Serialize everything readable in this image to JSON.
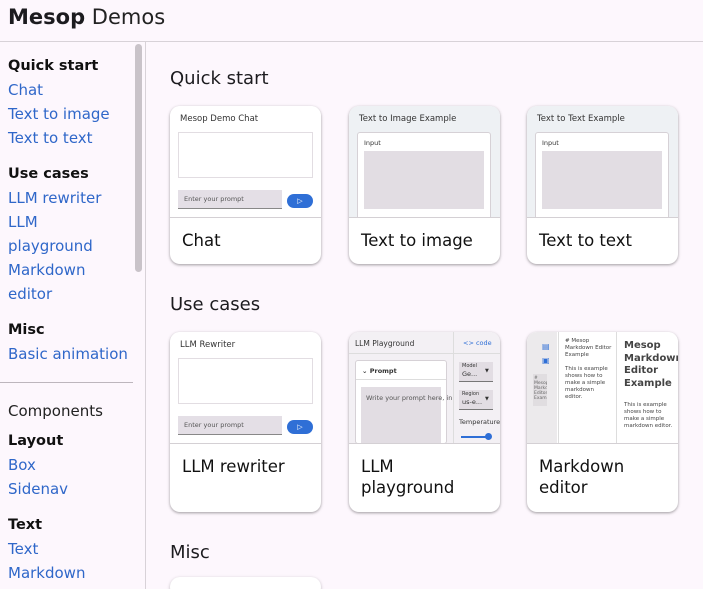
{
  "header": {
    "brand_bold": "Mesop",
    "brand_light": "Demos"
  },
  "sidebar": {
    "quick_start": {
      "title": "Quick start",
      "items": [
        "Chat",
        "Text to image",
        "Text to text"
      ]
    },
    "use_cases": {
      "title": "Use cases",
      "items": [
        "LLM rewriter",
        "LLM",
        "playground",
        "Markdown",
        "editor"
      ]
    },
    "misc": {
      "title": "Misc",
      "items": [
        "Basic animation"
      ]
    },
    "components_label": "Components",
    "layout": {
      "title": "Layout",
      "items": [
        "Box",
        "Sidenav"
      ]
    },
    "text": {
      "title": "Text",
      "items": [
        "Text",
        "Markdown"
      ]
    }
  },
  "main": {
    "sections": {
      "quick_start": "Quick start",
      "use_cases": "Use cases",
      "misc": "Misc"
    },
    "cards": {
      "chat": {
        "label": "Chat",
        "thumb_title": "Mesop Demo Chat",
        "thumb_placeholder": "Enter your prompt",
        "thumb_send": "▷"
      },
      "text_to_image": {
        "label": "Text to image",
        "thumb_title": "Text to Image Example",
        "thumb_input": "Input"
      },
      "text_to_text": {
        "label": "Text to text",
        "thumb_title": "Text to Text Example",
        "thumb_input": "Input"
      },
      "llm_rewriter": {
        "label": "LLM rewriter",
        "thumb_title": "LLM Rewriter",
        "thumb_placeholder": "Enter your prompt",
        "thumb_send": "▷"
      },
      "llm_playground": {
        "label_line1": "LLM",
        "label_line2": "playground",
        "thumb_title": "LLM Playground",
        "thumb_code": "<> code",
        "thumb_prompt": "Prompt",
        "thumb_prompt_placeholder": "Write your prompt here, in",
        "thumb_model_label": "Model",
        "thumb_model_value": "Ge...",
        "thumb_region_label": "Region",
        "thumb_region_value": "us-e...",
        "thumb_temperature": "Temperature"
      },
      "markdown_editor": {
        "label_line1": "Markdown",
        "label_line2": "editor",
        "thumb_md_source": "# Mesop Markdown Editor Example",
        "thumb_md_source_body": "This is example shows how to make a simple markdown editor.",
        "thumb_heading": "Mesop Markdown Editor Example",
        "thumb_body": "This is example shows how to make a simple markdown editor.",
        "thumb_side_text": "# Mesop Markdown Editor Example"
      }
    }
  },
  "colors": {
    "background": "#fdf7fd",
    "link": "#2f67c9",
    "accent_button": "#2f6fd6"
  }
}
